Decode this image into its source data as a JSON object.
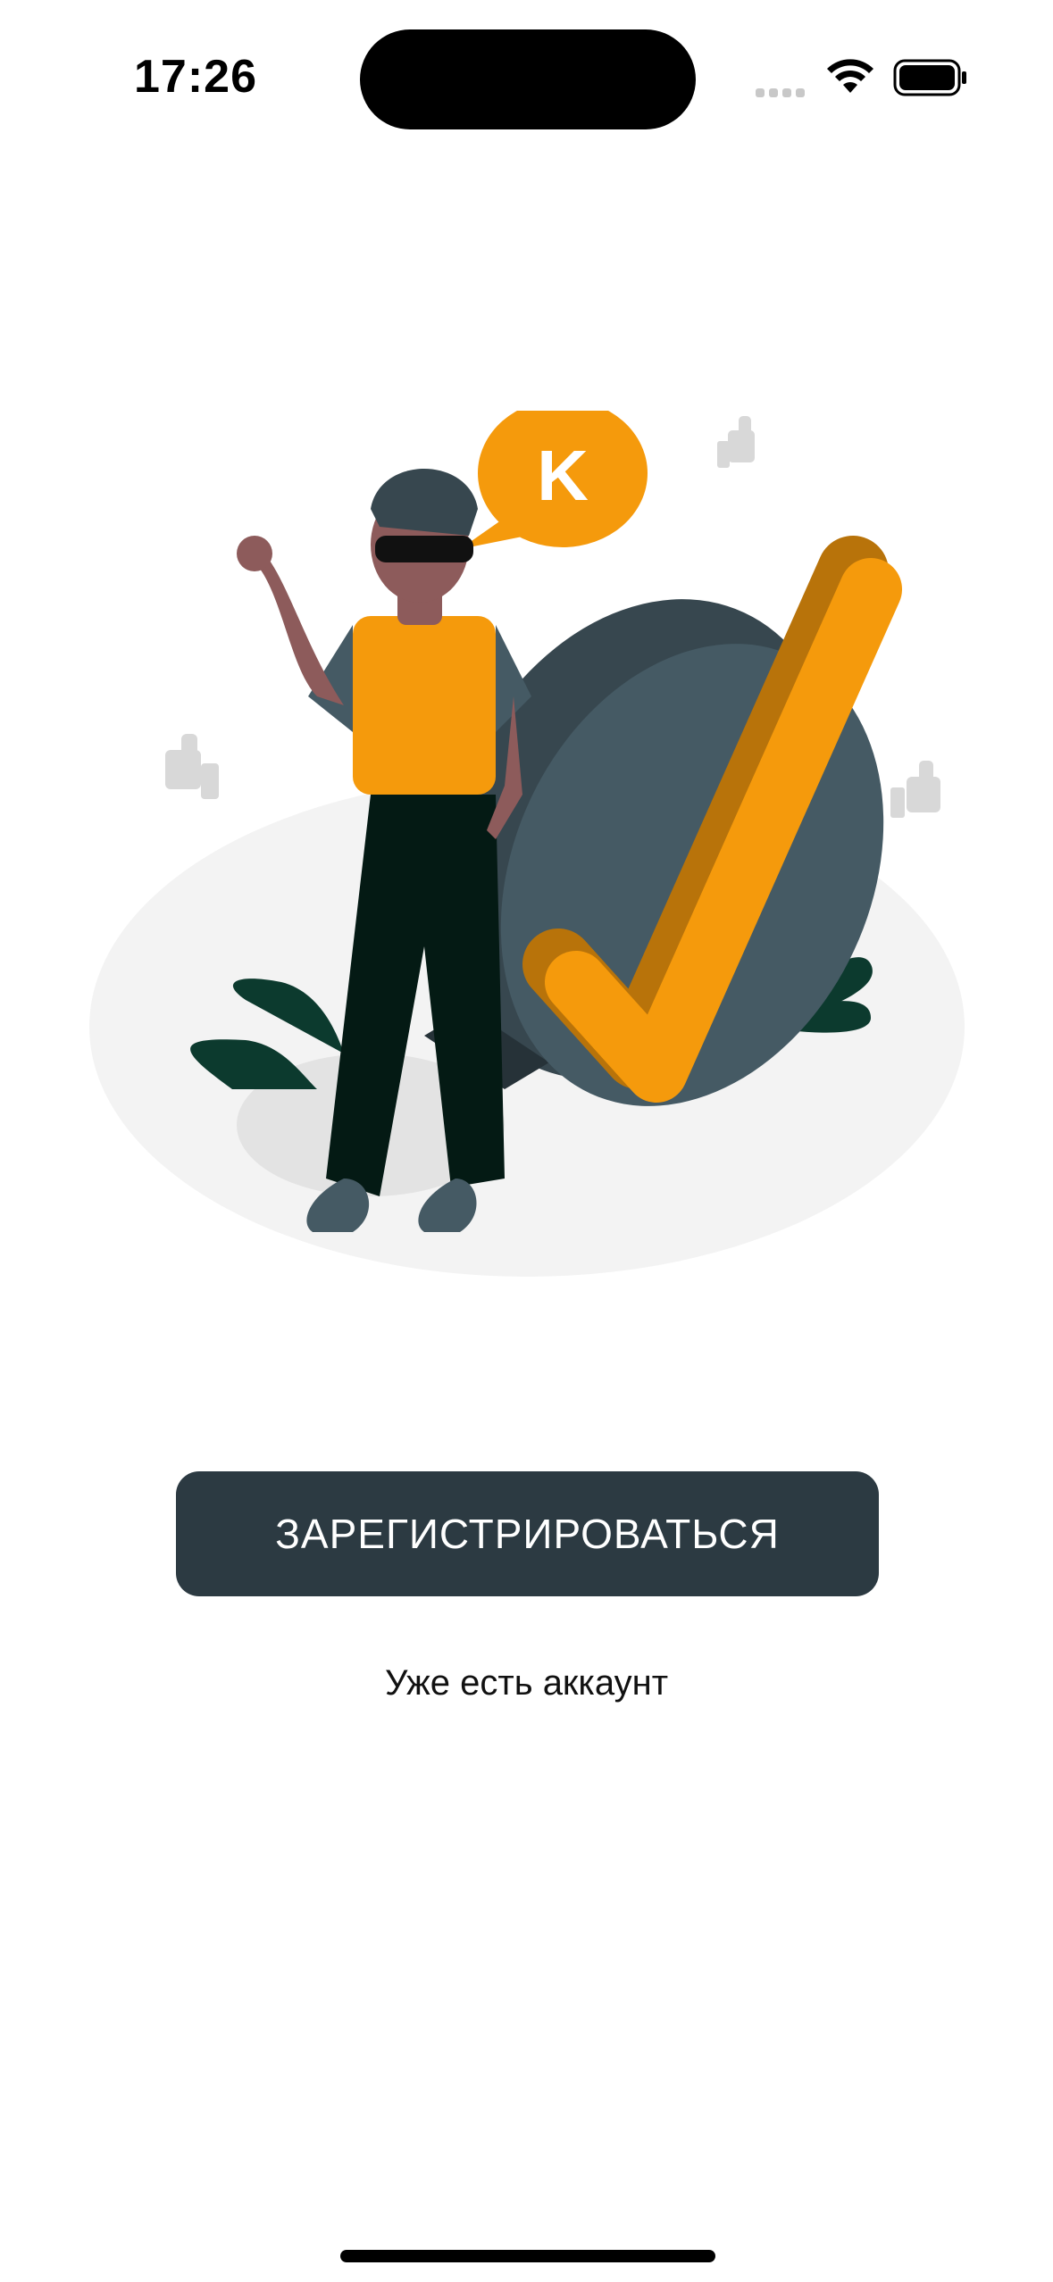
{
  "status_bar": {
    "time": "17:26",
    "icons": [
      "signal-icon",
      "wifi-icon",
      "battery-icon"
    ]
  },
  "illustration": {
    "speech_bubble_text": "K",
    "icon": "checkmark-illustration",
    "colors": {
      "accent": "#f59a0c",
      "dark": "#455a64",
      "plant": "#0c3a2e"
    }
  },
  "actions": {
    "register_label": "ЗАРЕГИСТРИРОВАТЬСЯ",
    "login_label": "Уже есть аккаунт"
  },
  "colors": {
    "button_bg": "#2c3a42",
    "button_text": "#ffffff",
    "page_bg": "#ffffff"
  }
}
